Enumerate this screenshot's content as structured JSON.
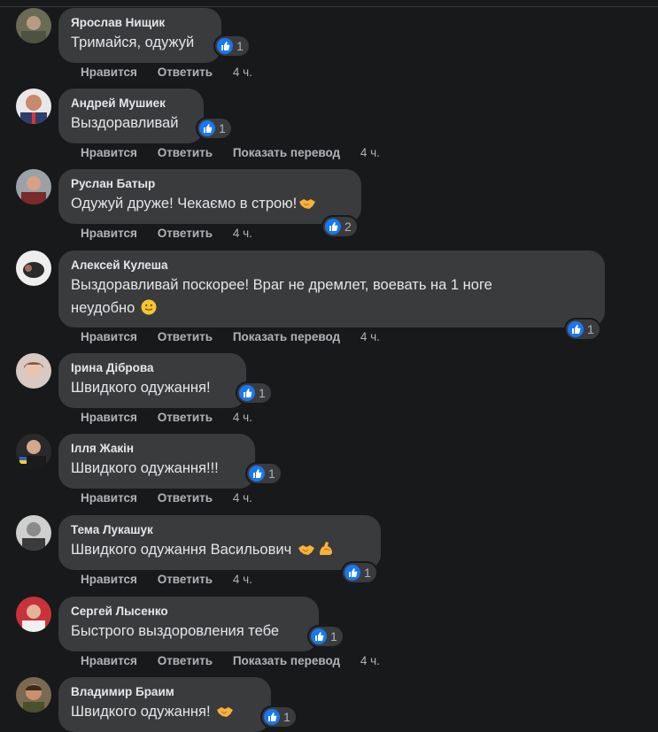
{
  "comments": [
    {
      "author": "Ярослав Нищик",
      "text": "Тримайся, одужуй",
      "likes": "1",
      "like_label": "Нравится",
      "reply_label": "Ответить",
      "translate_label": "",
      "time": "4 ч."
    },
    {
      "author": "Андрей Мушиек",
      "text": "Выздоравливай",
      "likes": "1",
      "like_label": "Нравится",
      "reply_label": "Ответить",
      "translate_label": "Показать перевод",
      "time": "4 ч."
    },
    {
      "author": "Руслан Батыр",
      "text": "Одужуй друже! Чекаємо в строю!",
      "likes": "2",
      "like_label": "Нравится",
      "reply_label": "Ответить",
      "translate_label": "",
      "time": "4 ч."
    },
    {
      "author": "Алексей Кулеша",
      "text_line1": "Выздоравливай поскорее! Враг не дремлет, воевать на 1 ноге",
      "text_line2": "неудобно",
      "likes": "1",
      "like_label": "Нравится",
      "reply_label": "Ответить",
      "translate_label": "Показать перевод",
      "time": "4 ч."
    },
    {
      "author": "Ірина Діброва",
      "text": "Швидкого одужання!",
      "likes": "1",
      "like_label": "Нравится",
      "reply_label": "Ответить",
      "translate_label": "",
      "time": "4 ч."
    },
    {
      "author": "Ілля Жакін",
      "text": "Швидкого одужання!!!",
      "likes": "1",
      "like_label": "Нравится",
      "reply_label": "Ответить",
      "translate_label": "",
      "time": "4 ч."
    },
    {
      "author": "Тема Лукашук",
      "text": "Швидкого одужання Васильович",
      "likes": "1",
      "like_label": "Нравится",
      "reply_label": "Ответить",
      "translate_label": "",
      "time": "4 ч."
    },
    {
      "author": "Сергей Лысенко",
      "text": "Быстрого выздоровления тебе",
      "likes": "1",
      "like_label": "Нравится",
      "reply_label": "Ответить",
      "translate_label": "Показать перевод",
      "time": "4 ч."
    },
    {
      "author": "Владимир Браим",
      "text": "Швидкого одужання!",
      "likes": "1",
      "like_label": "",
      "reply_label": "",
      "translate_label": "",
      "time": ""
    }
  ],
  "colors": {
    "background": "#18191a",
    "bubble": "#3a3b3c",
    "text": "#e4e6eb",
    "secondary": "#b0b3b8",
    "like_blue": "#1877f2"
  },
  "icons": [
    "like-thumb-icon",
    "handshake-emoji-icon",
    "smile-emoji-icon",
    "flexed-biceps-emoji-icon"
  ]
}
